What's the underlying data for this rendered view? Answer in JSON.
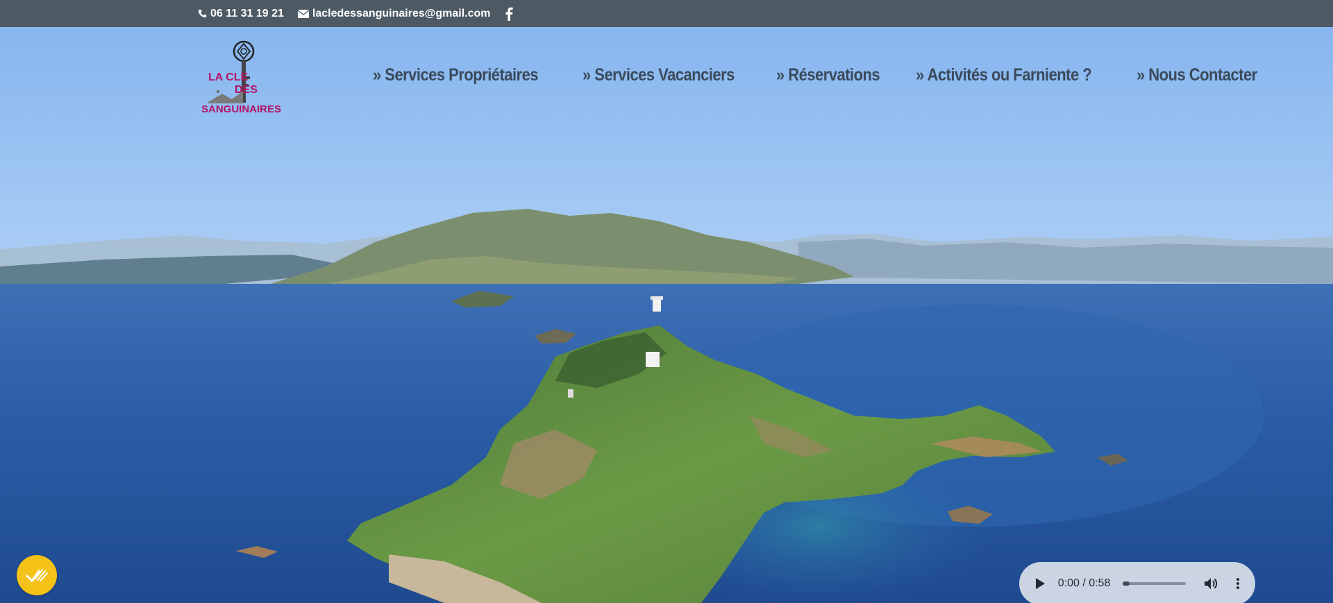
{
  "topbar": {
    "phone": "06 11 31 19 21",
    "email": "lacledessanguinaires@gmail.com",
    "phone_icon": "phone-icon",
    "email_icon": "envelope-icon",
    "social_icon": "facebook-icon"
  },
  "logo": {
    "line1": "LA CLE",
    "line1b": "DES",
    "line2": "SANGUINAIRES",
    "icon": "key-icon",
    "brand_color": "#b01265"
  },
  "nav": {
    "items": [
      {
        "label": "» Services Propriétaires"
      },
      {
        "label": "» Services Vacanciers"
      },
      {
        "label": "» Réservations"
      },
      {
        "label": "» Activités ou Farniente ?"
      },
      {
        "label": "» Nous Contacter"
      }
    ]
  },
  "badge": {
    "icon": "check-marks-icon",
    "color": "#f5c218"
  },
  "audio": {
    "time": "0:00 / 0:58",
    "progress": 0,
    "play_icon": "play-icon",
    "volume_icon": "volume-icon",
    "more_icon": "more-vert-icon"
  }
}
